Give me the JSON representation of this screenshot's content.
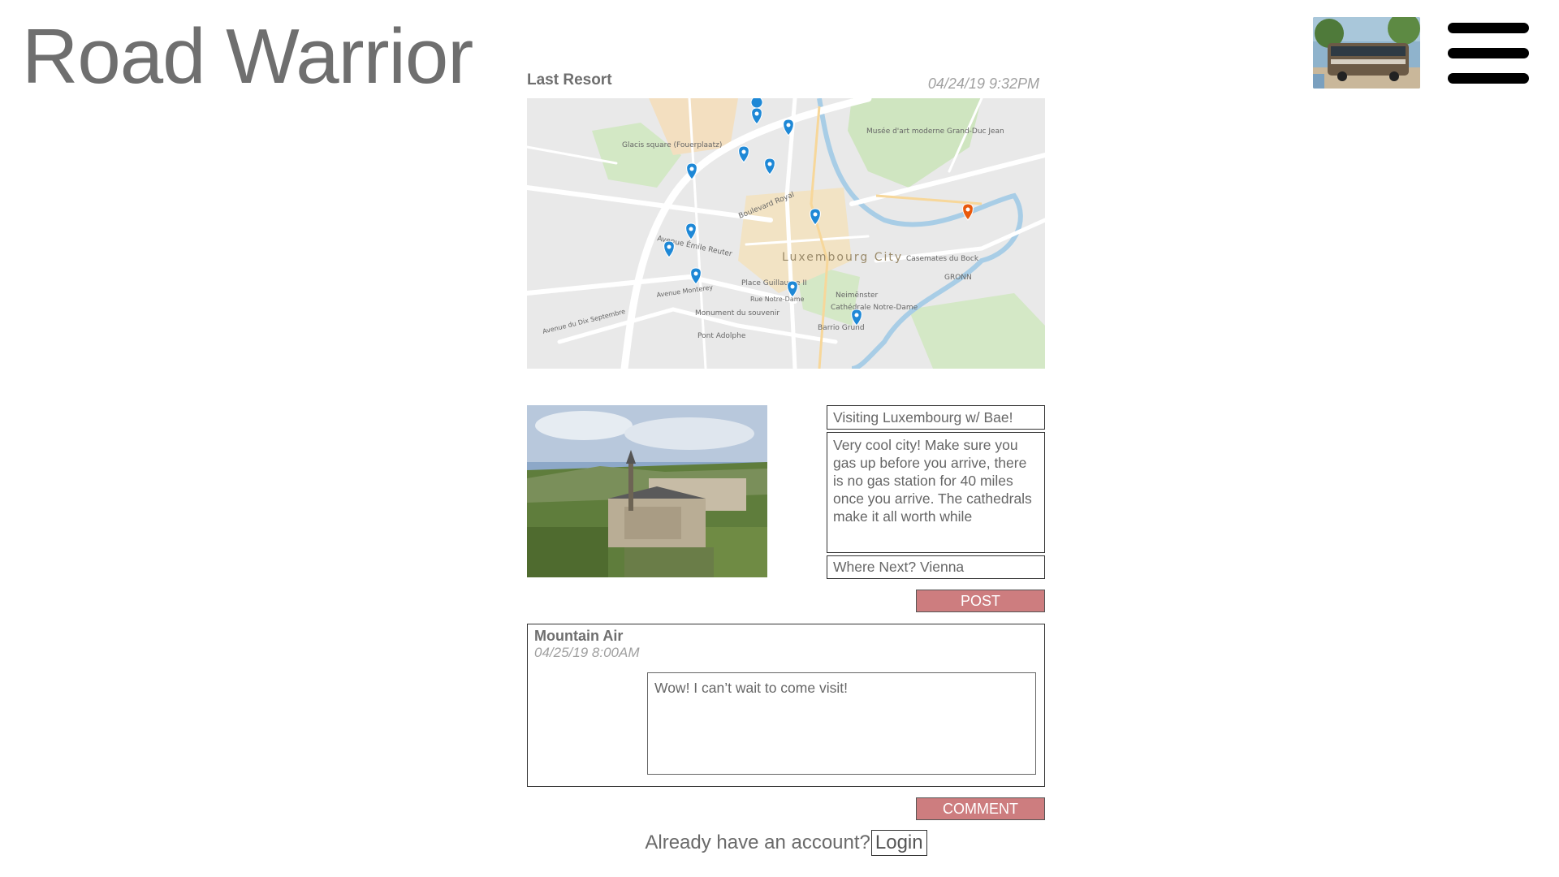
{
  "header": {
    "app_title": "Road Warrior",
    "avatar_icon": "rv-bus-photo",
    "menu_icon": "hamburger-menu-icon"
  },
  "post": {
    "author": "Last Resort",
    "timestamp": "04/24/19 9:32PM",
    "map": {
      "city_label": "Luxembourg City",
      "places": [
        "Musée d'art moderne Grand-Duc Jean",
        "Glacis square (Fouerplaatz)",
        "Boulevard Royal",
        "Avenue Émile Reuter",
        "Place Guillaume II",
        "Casemates du Bock",
        "GRONN",
        "Neimënster",
        "Cathédrale Notre-Dame",
        "Monument du souvenir",
        "Pont Adolphe",
        "Barrio Grund",
        "Rue Notre-Dame",
        "Avenue du Dix Septembre",
        "Avenue Monterey"
      ],
      "marker_colors": {
        "visited": "#1e88d6",
        "current": "#e8590c"
      }
    },
    "photo_icon": "luxembourg-abbey-photo",
    "title_value": "Visiting Luxembourg w/ Bae!",
    "body_value": "Very cool city! Make sure you gas up before you arrive, there is no gas station for 40 miles once you arrive. The cathedrals make it all worth while",
    "next_value": "Where Next? Vienna",
    "post_button": "POST"
  },
  "comment": {
    "author": "Mountain Air",
    "timestamp": "04/25/19 8:00AM",
    "text": "Wow! I can’t wait to come visit!",
    "comment_button": "COMMENT"
  },
  "footer": {
    "prompt": "Already have an account?",
    "login_link": "Login"
  },
  "colors": {
    "accent_button": "#cd7d7f",
    "title_text": "#6f6f6f"
  }
}
